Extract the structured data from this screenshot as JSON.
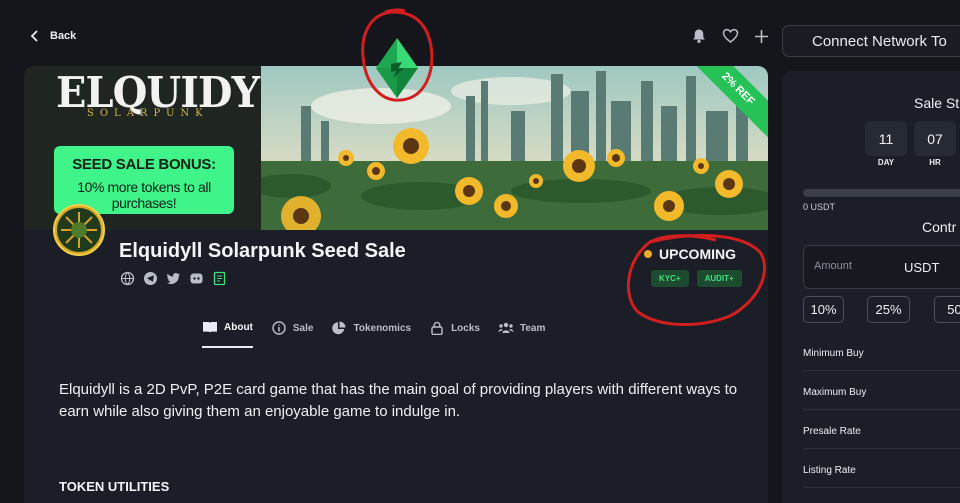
{
  "nav": {
    "back_label": "Back",
    "icons": [
      "bell-icon",
      "heart-icon",
      "plus-icon"
    ],
    "connect_label": "Connect Network To"
  },
  "banner": {
    "brand": "ELQUIDYLL",
    "brand_sub": "SOLARPUNK",
    "bonus_title": "SEED SALE BONUS:",
    "bonus_text": "10% more tokens to all purchases!",
    "ribbon": "2% REF"
  },
  "project": {
    "title": "Elquidyll Solarpunk Seed Sale",
    "socials": [
      "globe-icon",
      "telegram-icon",
      "twitter-icon",
      "discord-icon",
      "document-icon"
    ],
    "status": "UPCOMING",
    "badges": [
      "KYC+",
      "AUDIT+"
    ]
  },
  "tabs": [
    {
      "label": "About",
      "icon": "book-icon"
    },
    {
      "label": "Sale",
      "icon": "info-icon"
    },
    {
      "label": "Tokenomics",
      "icon": "pie-icon"
    },
    {
      "label": "Locks",
      "icon": "lock-icon"
    },
    {
      "label": "Team",
      "icon": "team-icon"
    }
  ],
  "content": {
    "description": "Elquidyll is a 2D PvP, P2E card game that has the main goal of providing players with different ways to earn while also giving them an enjoyable game to indulge in.",
    "section_heading": "TOKEN UTILITIES"
  },
  "sale_panel": {
    "title": "Sale St",
    "countdown": [
      {
        "value": "11",
        "label": "DAY"
      },
      {
        "value": "07",
        "label": "HR"
      }
    ],
    "progress_fraction": 0,
    "raised": "0 USDT",
    "contribute_title": "Contr",
    "amount_placeholder": "Amount",
    "currency": "USDT",
    "quick_amounts": [
      "10%",
      "25%",
      "50"
    ],
    "rows": [
      "Minimum Buy",
      "Maximum Buy",
      "Presale Rate",
      "Listing Rate"
    ]
  },
  "colors": {
    "background": "#14161b",
    "card": "#1b1e26",
    "accent_green": "#3ff58a",
    "status_dot": "#f0a92c",
    "badge_bg": "#1d4b30",
    "badge_text": "#3fe07e",
    "annotation_red": "#d11f1f"
  }
}
